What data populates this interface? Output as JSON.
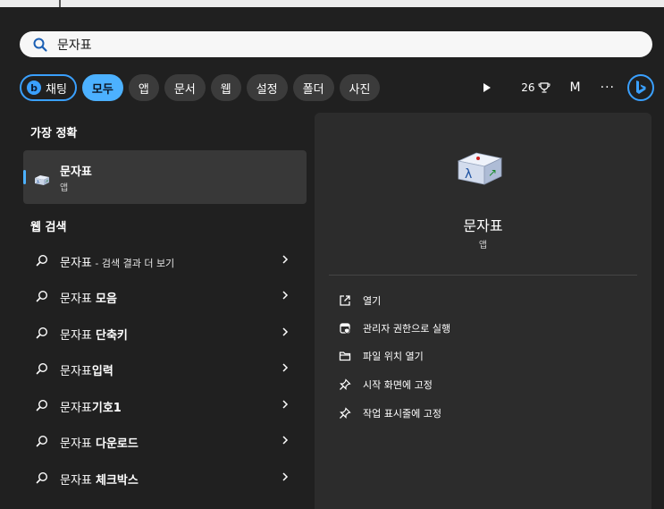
{
  "search": {
    "query": "문자표"
  },
  "filters": {
    "chat": "채팅",
    "items": [
      "모두",
      "앱",
      "문서",
      "웹",
      "설정",
      "폴더",
      "사진"
    ],
    "active_index": 0,
    "points": "26",
    "account_initial": "M",
    "more": "···"
  },
  "best_match": {
    "title": "가장 정확",
    "name": "문자표",
    "type": "앱"
  },
  "web_search": {
    "title": "웹 검색",
    "rows": [
      {
        "base": "문자표",
        "extra": " - 검색 결과 더 보기"
      },
      {
        "base": "문자표 ",
        "extra": "모음"
      },
      {
        "base": "문자표 ",
        "extra": "단축키"
      },
      {
        "base": "문자표",
        "extra": "입력"
      },
      {
        "base": "문자표",
        "extra": "기호1"
      },
      {
        "base": "문자표 ",
        "extra": "다운로드"
      },
      {
        "base": "문자표 ",
        "extra": "체크박스"
      }
    ]
  },
  "details": {
    "name": "문자표",
    "type": "앱",
    "actions": [
      {
        "icon": "open-external-icon",
        "label": "열기"
      },
      {
        "icon": "admin-shield-icon",
        "label": "관리자 권한으로 실행"
      },
      {
        "icon": "folder-icon",
        "label": "파일 위치 열기"
      },
      {
        "icon": "pin-icon",
        "label": "시작 화면에 고정"
      },
      {
        "icon": "pin-icon",
        "label": "작업 표시줄에 고정"
      }
    ]
  },
  "colors": {
    "accent": "#4cb1ff",
    "background": "#202020",
    "panel": "#2c2c2c",
    "chip": "#3b3b3b"
  }
}
